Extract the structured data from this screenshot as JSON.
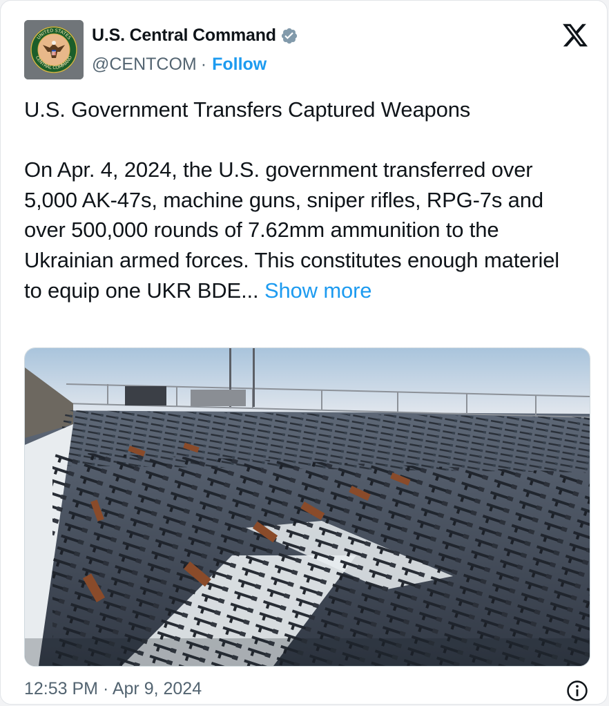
{
  "post": {
    "author": {
      "display_name": "U.S. Central Command",
      "handle": "@CENTCOM",
      "separator": "·",
      "follow_label": "Follow",
      "verified_badge_color": "#829aab",
      "avatar_seal_text_top": "UNITED STATES",
      "avatar_seal_text_bottom": "CENTRAL COMMAND"
    },
    "title": "U.S. Government Transfers Captured Weapons",
    "body": "On Apr. 4, 2024, the U.S. government transferred over 5,000 AK-47s, machine guns, sniper rifles, RPG-7s and over 500,000 rounds of 7.62mm ammunition to the Ukrainian armed forces. This constitutes enough materiel to equip one UKR BDE...",
    "show_more_label": "Show more",
    "timestamp": "12:53 PM · Apr 9, 2024",
    "image_description_icon": "info-icon"
  },
  "colors": {
    "link": "#1d9bf0",
    "text": "#0f1419",
    "secondary": "#536471"
  }
}
